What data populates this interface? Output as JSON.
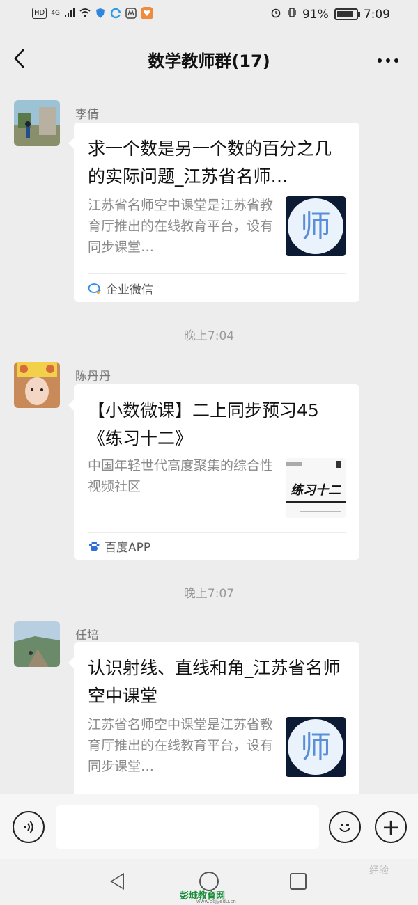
{
  "status_bar": {
    "network_hd": "HD",
    "network_type": "4G",
    "battery": "91%",
    "time": "7:09"
  },
  "header": {
    "title": "数学教师群(17)",
    "back_icon": "chevron-left-icon",
    "more_icon": "more-dots-icon"
  },
  "messages": [
    {
      "sender": "李倩",
      "card": {
        "title": "求一个数是另一个数的百分之几的实际问题_江苏省名师…",
        "description": "江苏省名师空中课堂是江苏省教育厅推出的在线教育平台，设有同步课堂…",
        "thumb_text": "师",
        "source": "企业微信",
        "source_icon": "wecom-icon"
      }
    },
    {
      "time": "晚上7:04"
    },
    {
      "sender": "陈丹丹",
      "card": {
        "title": "【小数微课】二上同步预习45《练习十二》",
        "description": "中国年轻世代高度聚集的综合性视频社区",
        "thumb_text": "练习十二",
        "source": "百度APP",
        "source_icon": "baidu-paw-icon"
      }
    },
    {
      "time": "晚上7:07"
    },
    {
      "sender": "任培",
      "card": {
        "title": "认识射线、直线和角_江苏省名师空中课堂",
        "description": "江苏省名师空中课堂是江苏省教育厅推出的在线教育平台，设有同步课堂…",
        "thumb_text": "师"
      }
    }
  ],
  "input_bar": {
    "voice_icon": "voice-icon",
    "emoji_icon": "emoji-icon",
    "plus_icon": "plus-icon",
    "plus_glyph": "+"
  },
  "watermarks": {
    "site": "彭城教育网",
    "site_url": "www.pcjyedu.cn",
    "jingyan": "经验"
  }
}
